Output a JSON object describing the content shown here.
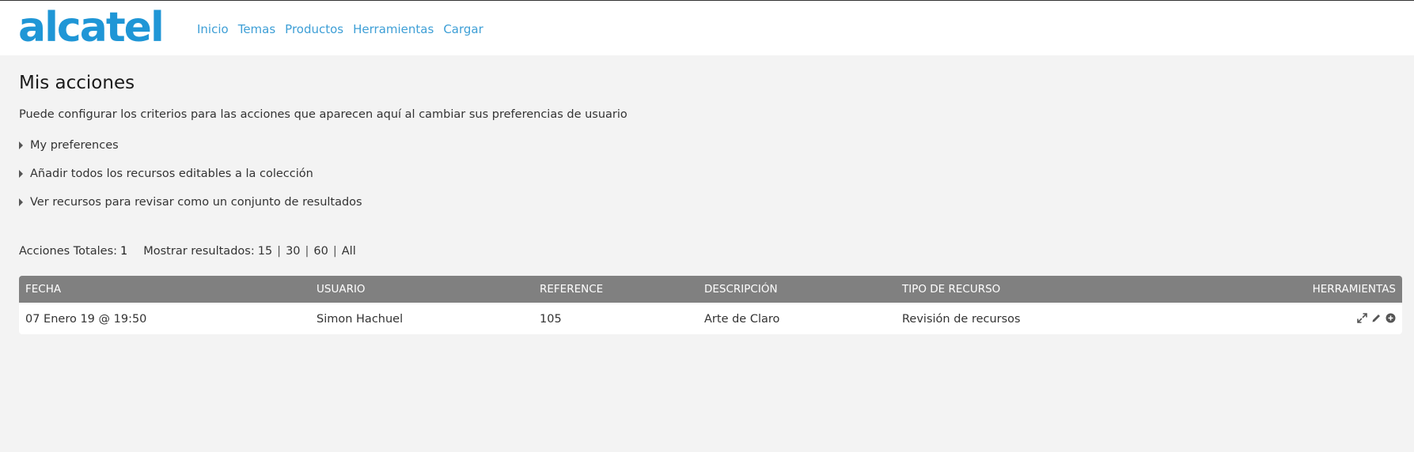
{
  "brand": {
    "logo_text": "alcatel",
    "color": "#1f96d6"
  },
  "nav": {
    "items": [
      {
        "label": "Inicio"
      },
      {
        "label": "Temas"
      },
      {
        "label": "Productos"
      },
      {
        "label": "Herramientas"
      },
      {
        "label": "Cargar"
      }
    ],
    "color": "#3e9fd6"
  },
  "page": {
    "title": "Mis acciones",
    "intro": "Puede configurar los criterios para las acciones que aparecen aquí al cambiar sus preferencias de usuario"
  },
  "toggles": [
    {
      "label": "My preferences"
    },
    {
      "label": "Añadir todos los recursos editables a la colección"
    },
    {
      "label": "Ver recursos para revisar como un conjunto de resultados"
    }
  ],
  "stats": {
    "total_label": "Acciones Totales:",
    "total_value": "1",
    "show_label": "Mostrar resultados:",
    "options": [
      "15",
      "30",
      "60",
      "All"
    ]
  },
  "table": {
    "columns": [
      "FECHA",
      "USUARIO",
      "REFERENCE",
      "DESCRIPCIÓN",
      "TIPO DE RECURSO",
      "HERRAMIENTAS"
    ],
    "rows": [
      {
        "fecha": "07 Enero 19 @ 19:50",
        "usuario": "Simon Hachuel",
        "reference": "105",
        "descripcion": "Arte de Claro",
        "tipo": "Revisión de recursos",
        "tools": [
          "expand-icon",
          "pencil-icon",
          "plus-circle-icon"
        ]
      }
    ],
    "header_bg": "#808080"
  }
}
